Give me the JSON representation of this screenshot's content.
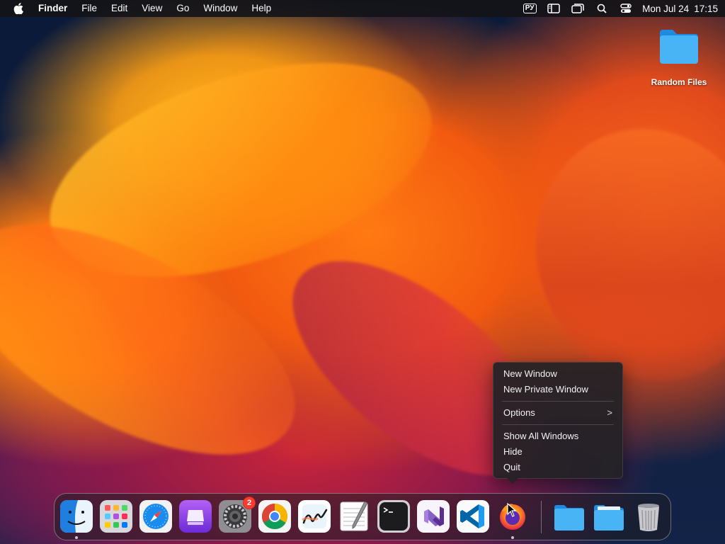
{
  "menubar": {
    "app_name": "Finder",
    "items": [
      "File",
      "Edit",
      "View",
      "Go",
      "Window",
      "Help"
    ],
    "input_source": "РУ",
    "date": "Mon Jul 24",
    "time": "17:15"
  },
  "desktop": {
    "folder_label": "Random Files"
  },
  "context_menu": {
    "items": [
      "New Window",
      "New Private Window",
      "Options",
      "Show All Windows",
      "Hide",
      "Quit"
    ],
    "submenu_indicator": ">"
  },
  "dock": {
    "apps": [
      "finder-icon",
      "launchpad-icon",
      "safari-icon",
      "podcast-app-icon",
      "system-settings-icon",
      "chrome-icon",
      "freeform-icon",
      "textedit-icon",
      "terminal-icon",
      "visual-studio-icon",
      "vscode-icon",
      "firefox-icon"
    ],
    "settings_badge": "2",
    "stack_items": [
      "folder-icon",
      "folder-icon",
      "trash-icon"
    ]
  },
  "colors": {
    "accent_blue": "#2d9cf0",
    "badge_red": "#ff3b30"
  }
}
